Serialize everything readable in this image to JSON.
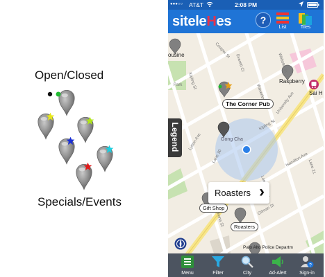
{
  "legend": {
    "open_closed_label": "Open/Closed",
    "specials_events_label": "Specials/Events",
    "dot_colors": {
      "closed": "#111111",
      "open": "#22bb33"
    },
    "star_colors": [
      "#e6e61a",
      "#b0e61a",
      "#1a2fd6",
      "#1acfe0",
      "#e01a1a"
    ]
  },
  "status_bar": {
    "carrier": "AT&T",
    "time": "2:08 PM",
    "signal": "●●●○○",
    "wifi_icon": "wifi-icon",
    "location_icon": "location-arrow-icon",
    "battery_icon": "battery-icon"
  },
  "app_bar": {
    "logo_main": "sitele",
    "logo_accent": "H",
    "logo_end": "es",
    "help_label": "?",
    "list_label": "List",
    "tiles_label": "Tiles",
    "colors": {
      "bar": "#1f74d6",
      "accent": "#e8314a"
    }
  },
  "map": {
    "legend_tab_label": "Legend",
    "callout_label": "Roasters",
    "callout_chevron": "›",
    "place_labels": {
      "ousine": "ousine",
      "raspberry": "Raspberry",
      "sai": "Sai H",
      "corner_pub": "The Corner Pub",
      "gift_shop": "Gift Shop",
      "roasters": "Roasters",
      "gong_cha": "Gong Cha",
      "police": "Palo Alto Police Departm"
    },
    "street_labels": {
      "kipling": "Kipling St",
      "university": "University Ave",
      "lytton": "Lytton Ave",
      "hamilton": "Hamilton Ave",
      "gilman": "Gilman St",
      "ramona": "Ramona St",
      "lane30": "Lane 30",
      "everett": "Everett Ct",
      "cowper": "Cowper St",
      "waverley": "Waverley St",
      "lane5": "Lane 5 Way",
      "lane21": "Lane 21",
      "webster": "Webster St",
      "park": "Park"
    }
  },
  "bottom_nav": {
    "menu_label": "Menu",
    "filter_label": "Filter",
    "city_label": "City",
    "ad_alert_label": "Ad-Alert",
    "sign_in_label": "Sign-in"
  }
}
